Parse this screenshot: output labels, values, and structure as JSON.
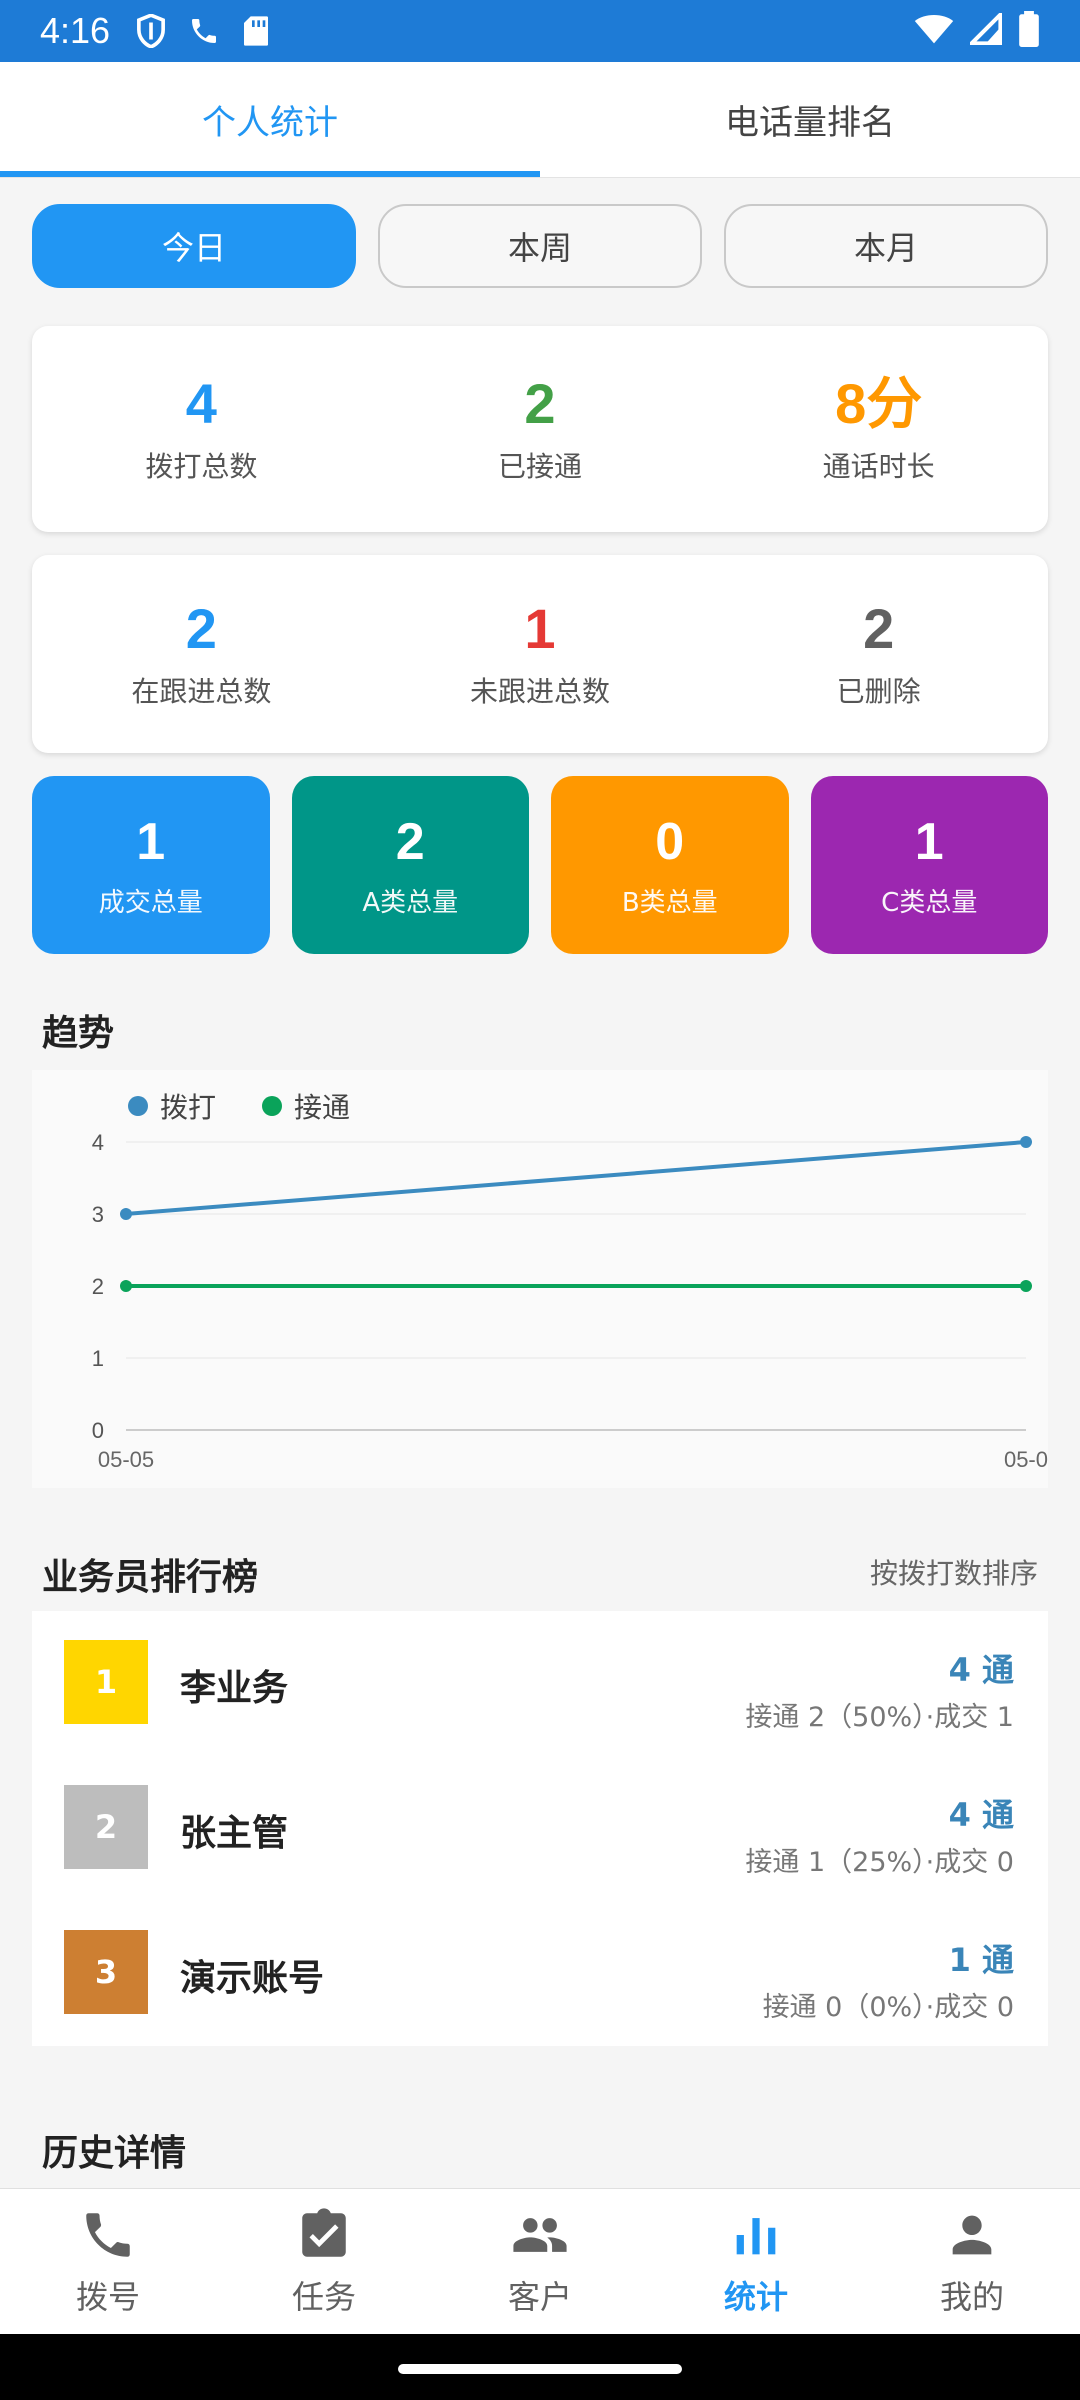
{
  "status_bar": {
    "time": "4:16",
    "icons": [
      "shield-icon",
      "phone-icon",
      "sd-card-icon",
      "wifi-icon",
      "signal-icon",
      "battery-icon"
    ]
  },
  "tabs": [
    {
      "label": "个人统计",
      "active": true
    },
    {
      "label": "电话量排名",
      "active": false
    }
  ],
  "period": {
    "options": [
      "今日",
      "本周",
      "本月"
    ],
    "selected": "今日"
  },
  "summary1": [
    {
      "value": "4",
      "label": "拨打总数"
    },
    {
      "value": "2",
      "label": "已接通"
    },
    {
      "value": "8分",
      "label": "通话时长"
    }
  ],
  "summary2": [
    {
      "value": "2",
      "label": "在跟进总数"
    },
    {
      "value": "1",
      "label": "未跟进总数"
    },
    {
      "value": "2",
      "label": "已删除"
    }
  ],
  "tiles": [
    {
      "value": "1",
      "label": "成交总量",
      "color": "#2196f3"
    },
    {
      "value": "2",
      "label": "A类总量",
      "color": "#009688"
    },
    {
      "value": "0",
      "label": "B类总量",
      "color": "#ff9800"
    },
    {
      "value": "1",
      "label": "C类总量",
      "color": "#9c27b0"
    }
  ],
  "trend": {
    "title": "趋势"
  },
  "chart_data": {
    "type": "line",
    "x": [
      "05-05",
      "05-0"
    ],
    "series": [
      {
        "name": "拨打",
        "values": [
          3,
          4
        ],
        "color": "#3b8bc0"
      },
      {
        "name": "接通",
        "values": [
          2,
          2
        ],
        "color": "#0aa35a"
      }
    ],
    "ylim": [
      0,
      4
    ],
    "yticks": [
      "0",
      "1",
      "2",
      "3",
      "4"
    ],
    "grid": true,
    "legend": "top-left"
  },
  "ranking": {
    "title": "业务员排行榜",
    "sort_label": "按拨打数排序",
    "rows": [
      {
        "rank": "1",
        "name": "李业务",
        "calls": "4 通",
        "detail": "接通 2（50%）·成交 1",
        "badge_color": "#ffd600"
      },
      {
        "rank": "2",
        "name": "张主管",
        "calls": "4 通",
        "detail": "接通 1（25%）·成交 0",
        "badge_color": "#bdbdbd"
      },
      {
        "rank": "3",
        "name": "演示账号",
        "calls": "1 通",
        "detail": "接通 0（0%）·成交 0",
        "badge_color": "#cd7f32"
      }
    ]
  },
  "history": {
    "title": "历史详情"
  },
  "bottom_nav": [
    {
      "label": "拨号",
      "icon": "phone-icon",
      "active": false
    },
    {
      "label": "任务",
      "icon": "clipboard-check-icon",
      "active": false
    },
    {
      "label": "客户",
      "icon": "people-icon",
      "active": false
    },
    {
      "label": "统计",
      "icon": "bar-chart-icon",
      "active": true
    },
    {
      "label": "我的",
      "icon": "person-icon",
      "active": false
    }
  ]
}
